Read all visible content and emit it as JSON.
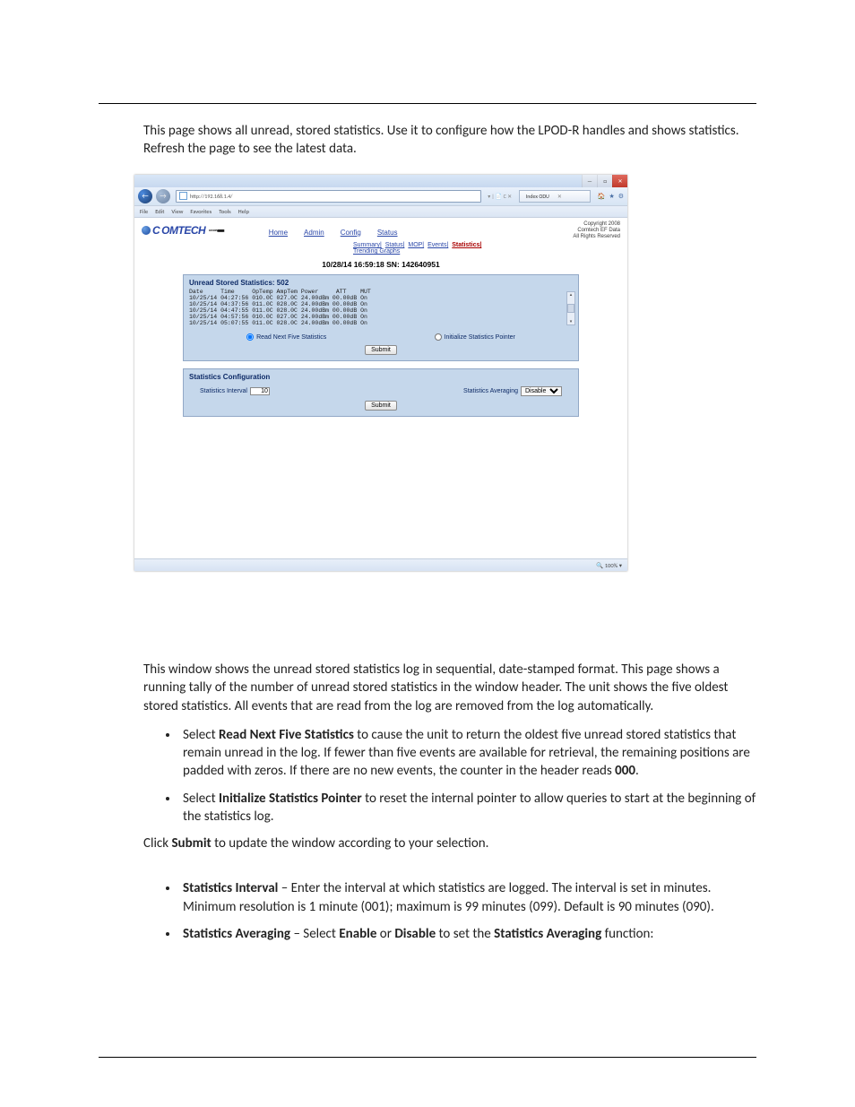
{
  "doc": {
    "intro": "This page shows all unread, stored statistics. Use it to configure how the LPOD-R handles and shows statistics. Refresh the page to see the latest data.",
    "desc": "This window shows the unread stored statistics log in sequential, date-stamped format. This page shows a running tally of the number of unread stored statistics in the window header. The unit shows the five oldest stored statistics. All events that are read from the log are removed from the log automatically.",
    "bullet1_pre": "Select ",
    "bullet1_bold": "Read Next Five Statistics",
    "bullet1_post": " to cause the unit to return the oldest five unread stored statistics that remain unread in the log. If fewer than five events are available for retrieval, the remaining positions are padded with zeros. If there are no new events, the counter in the header reads ",
    "bullet1_bold2": "000",
    "bullet1_end": ".",
    "bullet2_pre": "Select ",
    "bullet2_bold": "Initialize Statistics Pointer",
    "bullet2_post": " to reset the internal pointer to allow queries to start at the beginning of the statistics log.",
    "submit_pre": "Click ",
    "submit_bold": "Submit",
    "submit_post": " to update the window according to your selection.",
    "bullet3_bold": "Statistics Interval",
    "bullet3_post": " – Enter the interval at which statistics are logged. The interval is set in minutes. Minimum resolution is 1 minute (001); maximum is 99 minutes (099). Default is 90 minutes (090).",
    "bullet4_bold": "Statistics Averaging",
    "bullet4_mid1": " – Select ",
    "bullet4_en": "Enable",
    "bullet4_mid2": " or ",
    "bullet4_dis": "Disable",
    "bullet4_mid3": " to set the ",
    "bullet4_fn": "Statistics Averaging",
    "bullet4_end": " function:"
  },
  "window": {
    "minimize": "—",
    "maximize": "□",
    "close": "✕",
    "back": "←",
    "fwd": "→",
    "url": "http://192.168.1.4/",
    "searchglyph": "🔎",
    "sep": " ▾ | 📄 C ✕ ",
    "tab_title": "Index ODU",
    "tab_close": "✕",
    "icon_home": "🏠",
    "icon_star": "★",
    "icon_gear": "⚙",
    "menus": [
      "File",
      "Edit",
      "View",
      "Favorites",
      "Tools",
      "Help"
    ],
    "zoom": "🔍 100%  ▾"
  },
  "app": {
    "brand": "OMTECH",
    "brand_sub": "EF DATA ▆▆▆▆",
    "tabs": [
      "Home",
      "Admin",
      "Config",
      "Status"
    ],
    "subnav": [
      "Summary|",
      "Status|",
      "MOP|",
      "Events|"
    ],
    "subnav_active": "Statistics|",
    "subnav2": "Trending Graphs",
    "copyright": "Copyright 2008\nComtech EF Data\nAll Rights Reserved",
    "stamp": "10/28/14  16:59:18  SN: 142640951",
    "panel1_title": "Unread Stored Statistics: 502",
    "log": "Date     Time     OpTemp AmpTem Power     ATT    MUT\n10/25/14 04:27:56 010.0C 027.0C 24.00dBm 00.00dB On\n10/25/14 04:37:56 011.0C 028.0C 24.00dBm 00.00dB On\n10/25/14 04:47:55 011.0C 028.0C 24.00dBm 00.00dB On\n10/25/14 04:57:56 010.0C 027.0C 24.00dBm 00.00dB On\n10/25/14 05:07:55 011.0C 028.0C 24.00dBm 00.00dB On",
    "scroll_up": "▴",
    "scroll_dn": "▾",
    "radio1": "Read Next Five Statistics",
    "radio2": "Initialize Statistics Pointer",
    "submit": "Submit",
    "panel2_title": "Statistics Configuration",
    "interval_label": "Statistics Interval",
    "interval_value": "10",
    "avg_label": "Statistics Averaging",
    "avg_value": "Disable"
  }
}
